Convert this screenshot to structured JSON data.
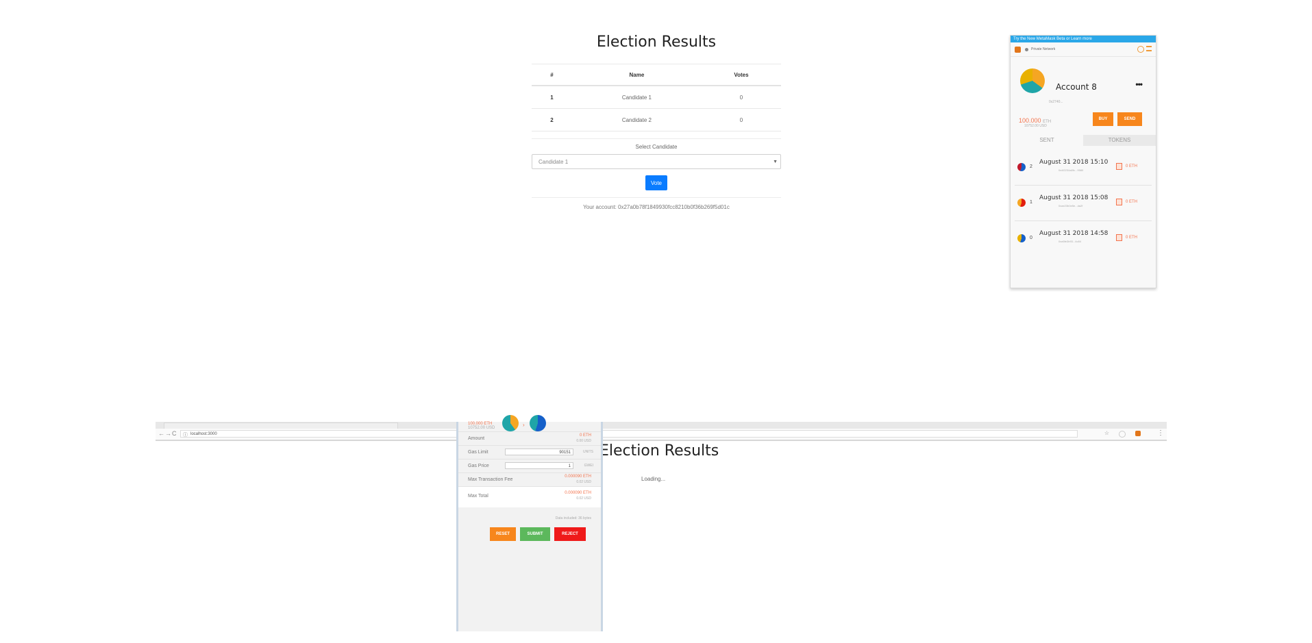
{
  "election_top": {
    "title": "Election Results",
    "table": {
      "headers": [
        "#",
        "Name",
        "Votes"
      ],
      "rows": [
        {
          "id": "1",
          "name": "Candidate 1",
          "votes": "0"
        },
        {
          "id": "2",
          "name": "Candidate 2",
          "votes": "0"
        }
      ]
    },
    "select_label": "Select Candidate",
    "select_value": "Candidate 1",
    "vote_button": "Vote",
    "account_line": "Your account: 0x27a0b78f1849930fcc8210b0f36b269f5d01c"
  },
  "metamask_top": {
    "banner": "Try the New MetaMask Beta or Learn more",
    "network": "Private Network",
    "account_name": "Account 8",
    "more": "•••",
    "address": "0x2740...",
    "balance_eth": "100.000",
    "balance_eth_unit": "ETH",
    "balance_usd": "10752.00 USD",
    "buy_label": "BUY",
    "send_label": "SEND",
    "tabs": [
      "SENT",
      "TOKENS"
    ],
    "transactions": [
      {
        "nonce": "2",
        "date": "August 31 2018 15:10",
        "to": "0x4f2234a0fc...9580",
        "amount": "0 ETH",
        "colors": [
          "#1560c9",
          "#c0182b"
        ]
      },
      {
        "nonce": "1",
        "date": "August 31 2018 15:08",
        "to": "0xae23b0e5e...da2f",
        "amount": "0 ETH",
        "colors": [
          "#e21d0e",
          "#f5a623"
        ]
      },
      {
        "nonce": "0",
        "date": "August 31 2018 14:58",
        "to": "0xa5fe3b93...4c84",
        "amount": "0 ETH",
        "colors": [
          "#1560c9",
          "#e8b100"
        ]
      }
    ],
    "accent": "#f7861c"
  },
  "browser": {
    "url": "localhost:3000",
    "back": "←",
    "forward": "→",
    "reload": "C",
    "info": "ⓘ",
    "star": "☆",
    "more": "⋮"
  },
  "election_bottom": {
    "title": "Election Results",
    "loading": "Loading..."
  },
  "metamask_confirm": {
    "from_eth": "100.000 ETH",
    "from_usd": "10752.00 USD",
    "arrow": "›",
    "amount_label": "Amount",
    "amount_eth": "0 ETH",
    "amount_usd": "0.00 USD",
    "gas_limit_label": "Gas Limit",
    "gas_limit_value": "90151",
    "gas_limit_unit": "UNITS",
    "gas_price_label": "Gas Price",
    "gas_price_value": "1",
    "gas_price_unit": "GWEI",
    "max_fee_label": "Max Transaction Fee",
    "max_fee_eth": "0.000090 ETH",
    "max_fee_usd": "0.02 USD",
    "max_total_label": "Max Total",
    "max_total_eth": "0.000090 ETH",
    "max_total_usd": "0.02 USD",
    "data_note": "Data included: 36 bytes",
    "reset_label": "RESET",
    "submit_label": "SUBMIT",
    "reject_label": "REJECT",
    "colors": {
      "reset": "#f7861c",
      "submit": "#5cb85c",
      "reject": "#ef1a1a"
    }
  }
}
